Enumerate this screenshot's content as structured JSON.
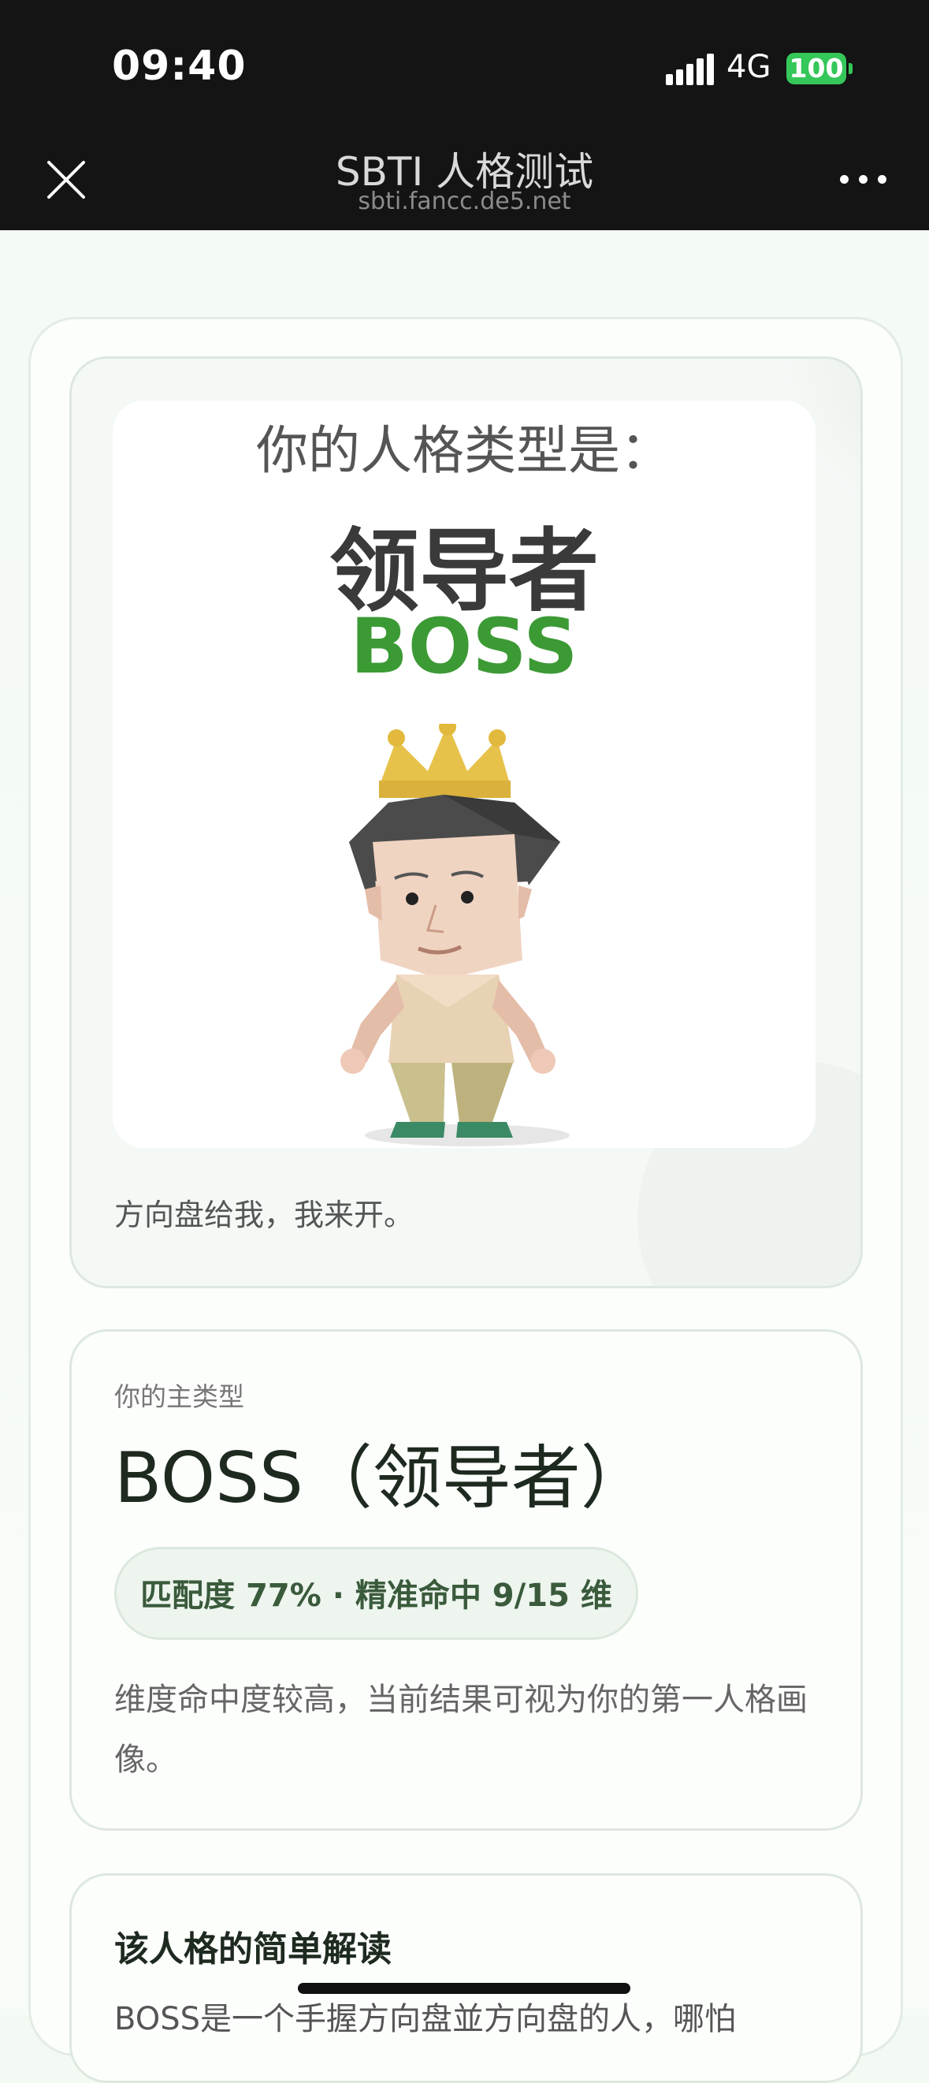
{
  "status_bar": {
    "time": "09:40",
    "network": "4G",
    "battery": "100",
    "battery_color": "#35c759"
  },
  "nav": {
    "title": "SBTI 人格测试",
    "url": "sbti.fancc.de5.net",
    "close_icon": "close-icon",
    "more_icon": "more-icon"
  },
  "hero": {
    "heading": "你的人格类型是：",
    "type_cn": "领导者",
    "type_code": "BOSS",
    "type_code_color": "#3c9a35",
    "illustration": "crowned-boss-character",
    "quote": "方向盘给我，我来开。"
  },
  "main_type": {
    "label": "你的主类型",
    "name": "BOSS（领导者）",
    "match": "匹配度 77% · 精准命中 9/15 维",
    "description": "维度命中度较高，当前结果可视为你的第一人格画像。"
  },
  "interpretation": {
    "title": "该人格的简单解读",
    "text": "BOSS是一个手握方向盘並方向盘的人，哪怕"
  }
}
